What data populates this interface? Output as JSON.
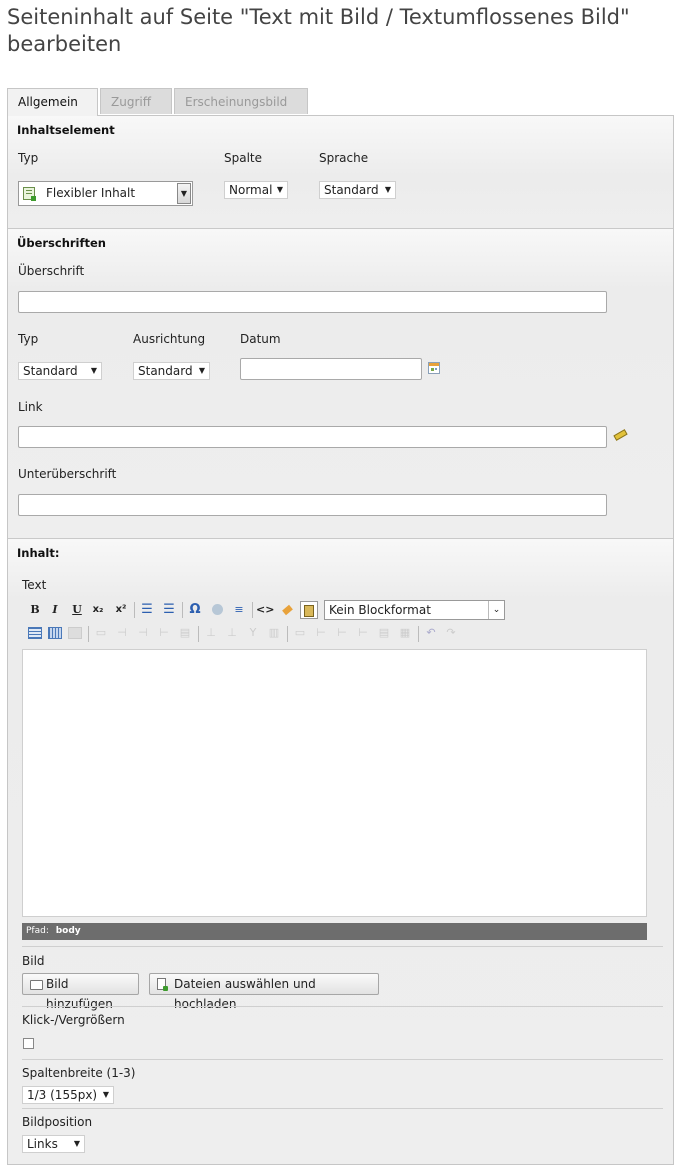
{
  "page": {
    "title": "Seiteninhalt auf Seite \"Text mit Bild / Textumflossenes Bild\" bearbeiten"
  },
  "tabs": [
    {
      "label": "Allgemein",
      "active": true
    },
    {
      "label": "Zugriff",
      "active": false
    },
    {
      "label": "Erscheinungsbild",
      "active": false
    }
  ],
  "inhaltselement": {
    "heading": "Inhaltselement",
    "typ_label": "Typ",
    "typ_value": "Flexibler Inhalt",
    "spalte_label": "Spalte",
    "spalte_value": "Normal",
    "sprache_label": "Sprache",
    "sprache_value": "Standard"
  },
  "ueberschriften": {
    "heading": "Überschriften",
    "ueberschrift_label": "Überschrift",
    "ueberschrift_value": "",
    "typ_label": "Typ",
    "typ_value": "Standard",
    "ausrichtung_label": "Ausrichtung",
    "ausrichtung_value": "Standard",
    "datum_label": "Datum",
    "datum_value": "",
    "link_label": "Link",
    "link_value": "",
    "unterueberschrift_label": "Unterüberschrift",
    "unterueberschrift_value": ""
  },
  "inhalt": {
    "heading": "Inhalt:",
    "text_label": "Text",
    "toolbar": {
      "bold": "B",
      "italic": "I",
      "underline": "U",
      "subscript": "x₂",
      "superscript": "x²",
      "special_char": "Ω",
      "source": "<>",
      "blockformat_value": "Kein Blockformat"
    },
    "editor_content": "",
    "path_label": "Pfad:",
    "path_value": "body",
    "bild_label": "Bild",
    "add_image_button": "Bild hinzufügen",
    "upload_button": "Dateien auswählen und hochladen",
    "klick_label": "Klick-/Vergrößern",
    "klick_checked": false,
    "spaltenbreite_label": "Spaltenbreite (1-3)",
    "spaltenbreite_value": "1/3 (155px)",
    "bildposition_label": "Bildposition",
    "bildposition_value": "Links"
  },
  "colors": {
    "panel_bg": "#eeeeee",
    "path_bar": "#6d6d6d",
    "calendar_icon": "#e8a23b"
  }
}
